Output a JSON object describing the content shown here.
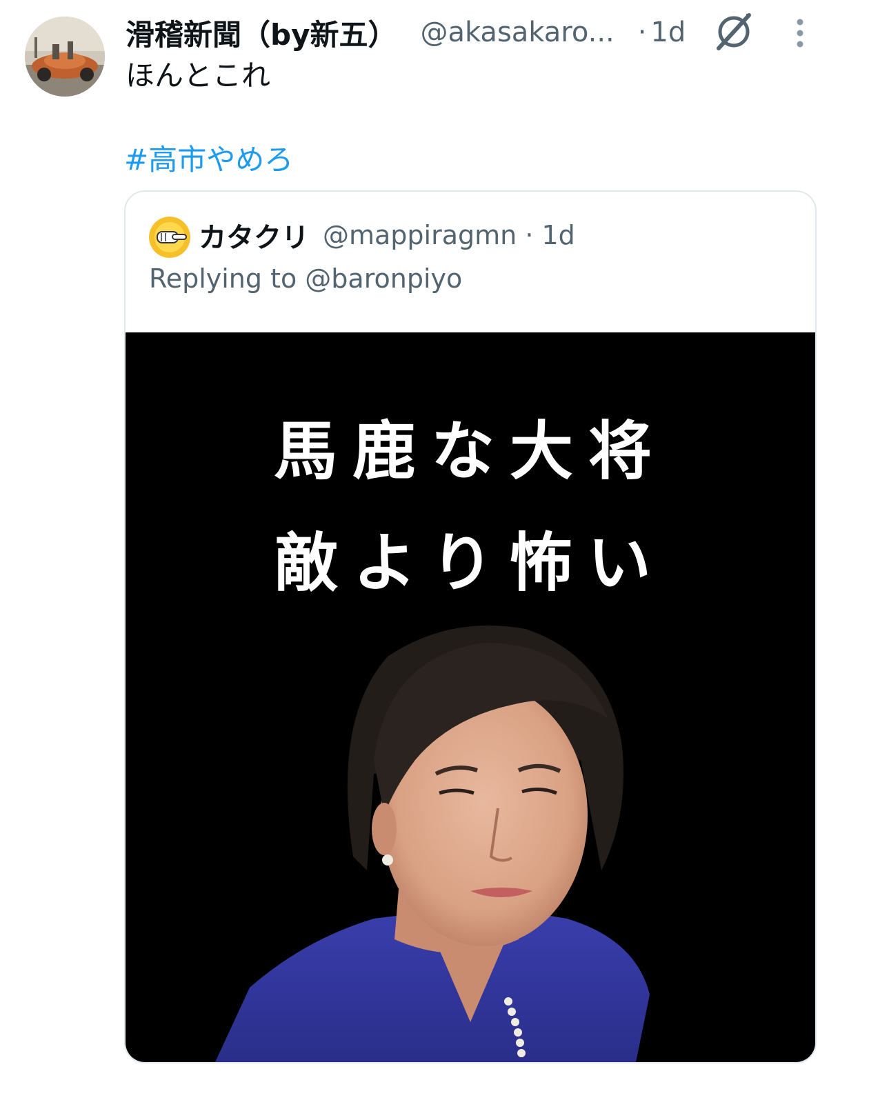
{
  "tweet": {
    "display_name": "滑稽新聞（by新五）",
    "handle": "@akasakaro...",
    "dot": "·",
    "time": "1d",
    "text": "ほんとこれ",
    "hashtag": "#高市やめろ",
    "hashtag_color": "#1d9bf0",
    "icons": {
      "avatar": "avatar-car-photo",
      "grok": "grok-icon",
      "more": "more-vertical-icon"
    }
  },
  "quote": {
    "display_name": "カタクリ",
    "handle_time": "@mappiragmn · 1d",
    "replying": "Replying to @baronpiyo",
    "avatar": "pointing-hand-emoji-avatar",
    "image": {
      "caption_line1": "馬鹿な大将",
      "caption_line2": "敵より怖い"
    }
  }
}
